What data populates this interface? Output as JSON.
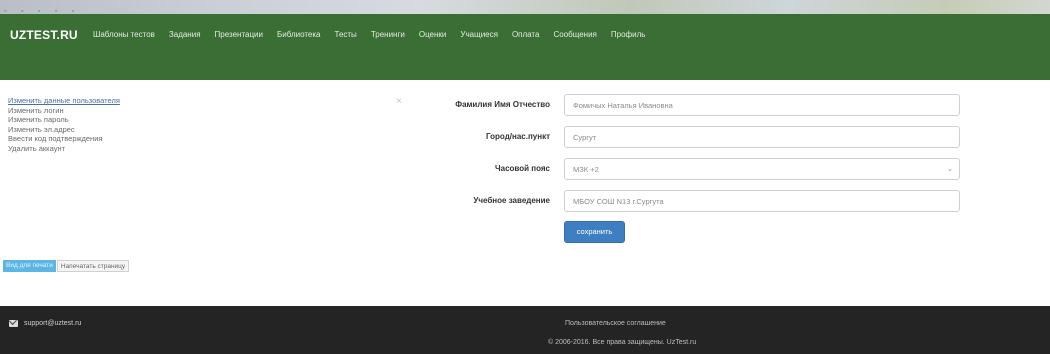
{
  "header": {
    "brand": "UZTEST.RU",
    "nav": [
      "Шаблоны тестов",
      "Задания",
      "Презентации",
      "Библиотека",
      "Тесты",
      "Тренинги",
      "Оценки",
      "Учащиеся",
      "Оплата",
      "Сообщения",
      "Профиль"
    ]
  },
  "sidebar": {
    "items": [
      "Изменить данные пользователя",
      "Изменить логин",
      "Изменить пароль",
      "Изменить эл.адрес",
      "Ввести код подтверждения",
      "Удалить аккаунт"
    ],
    "close_glyph": "×"
  },
  "form": {
    "fields": [
      {
        "label": "Фамилия Имя Отчество",
        "value": "Фомичых Наталья Ивановна"
      },
      {
        "label": "Город/нас.пункт",
        "value": "Сургут"
      },
      {
        "label": "Часовой пояс",
        "value": "МЗК +2"
      },
      {
        "label": "Учебное заведение",
        "value": "МБОУ СОШ N13 г.Сургута"
      }
    ],
    "save_label": "сохранить"
  },
  "print": {
    "view_label": "Вид для печати",
    "print_label": "Напечатать страницу"
  },
  "footer": {
    "email": "support@uztest.ru",
    "terms": "Пользовательское соглашение",
    "copyright": "© 2006-2016. Все права защищены. UzTest.ru"
  },
  "colors": {
    "nav_bg": "#3a6e35",
    "footer_bg": "#242424",
    "save_button": "#3d7fc1",
    "print_primary": "#5bb6e3"
  }
}
